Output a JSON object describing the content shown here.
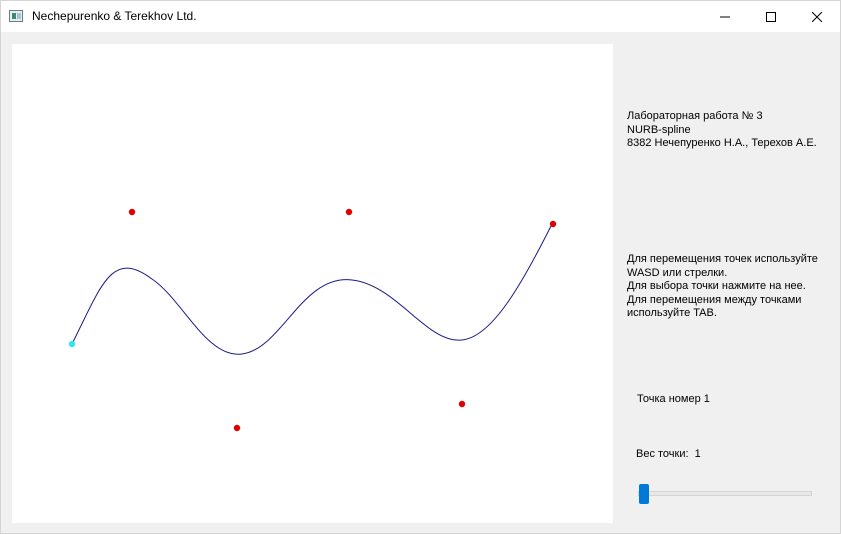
{
  "window": {
    "title": "Nechepurenko & Terekhov Ltd."
  },
  "icons": {
    "app": "app-window-icon",
    "minimize": "minimize-icon",
    "maximize": "maximize-icon",
    "close": "close-icon"
  },
  "info": {
    "lab_title": "Лабораторная работа № 3",
    "subject": "NURB-spline",
    "authors": "8382 Нечепуренко Н.А., Терехов А.Е."
  },
  "help": {
    "line1": "Для перемещения точек используйте",
    "line2": "WASD или стрелки.",
    "line3": "Для выбора точки нажмите на нее.",
    "line4": "Для перемещения между точками",
    "line5": "используйте TAB."
  },
  "point": {
    "label": "Точка номер 1",
    "weight_label": "Вес точки:  1",
    "weight_slider_fraction": 0.0
  },
  "colors": {
    "curve": "#1a1a8c",
    "control_point": "#e00000",
    "selected_point": "#33e5ee",
    "slider": "#0078d7"
  }
}
